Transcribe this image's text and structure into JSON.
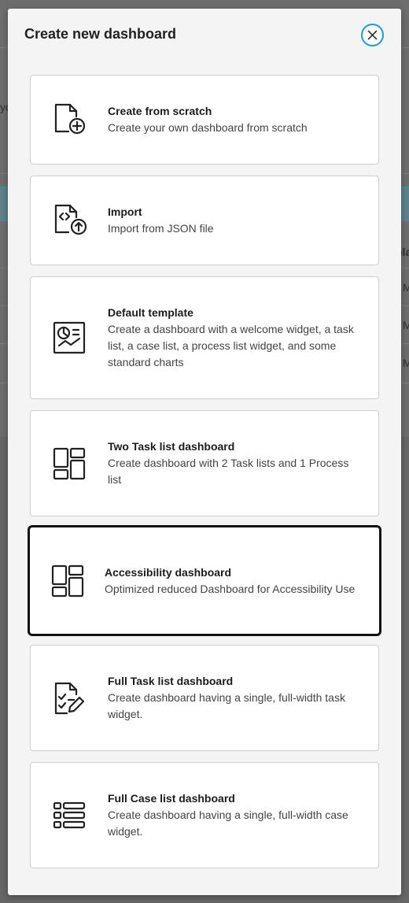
{
  "modal": {
    "title": "Create new dashboard",
    "close_icon": "close-icon"
  },
  "background": {
    "fragments": [
      "yo",
      "pla",
      "M",
      "M",
      "M"
    ]
  },
  "options": [
    {
      "title": "Create from scratch",
      "description": "Create your own dashboard from scratch",
      "icon": "file-plus-icon"
    },
    {
      "title": "Import",
      "description": "Import from JSON file",
      "icon": "file-code-upload-icon"
    },
    {
      "title": "Default template",
      "description": "Create a dashboard with a welcome widget, a task list, a case list, a process list widget, and some standard charts",
      "icon": "dashboard-chart-icon"
    },
    {
      "title": "Two Task list dashboard",
      "description": "Create dashboard with 2 Task lists and 1 Process list",
      "icon": "layout-grid-icon"
    },
    {
      "title": "Accessibility dashboard",
      "description": "Optimized reduced Dashboard for Accessibility Use",
      "icon": "layout-grid-icon",
      "focused": true
    },
    {
      "title": "Full Task list dashboard",
      "description": "Create dashboard having a single, full-width task widget.",
      "icon": "task-list-edit-icon"
    },
    {
      "title": "Full Case list dashboard",
      "description": "Create dashboard having a single, full-width case widget.",
      "icon": "case-list-icon"
    }
  ],
  "colors": {
    "focus_ring": "#1f9ad6",
    "focused_border": "#111111"
  }
}
